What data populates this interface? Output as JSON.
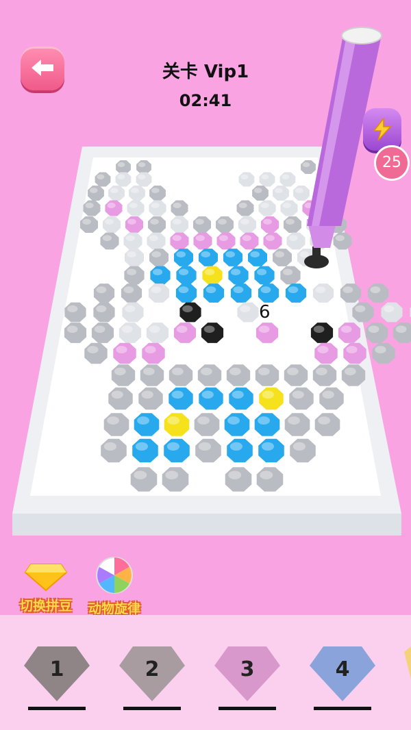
{
  "header": {
    "level_title": "关卡 Vip1",
    "timer": "02:41"
  },
  "power": {
    "icon": "lightning-icon",
    "count": "25"
  },
  "board": {
    "hint_number": "6"
  },
  "tools": [
    {
      "label": "切换拼豆",
      "icon": "diamond-icon"
    },
    {
      "label": "动物旋律",
      "icon": "swirl-candy-icon"
    }
  ],
  "palette": [
    {
      "number": "1",
      "color": "#8f8587"
    },
    {
      "number": "2",
      "color": "#a99ca1"
    },
    {
      "number": "3",
      "color": "#d898cc"
    },
    {
      "number": "4",
      "color": "#8aa3da"
    }
  ]
}
